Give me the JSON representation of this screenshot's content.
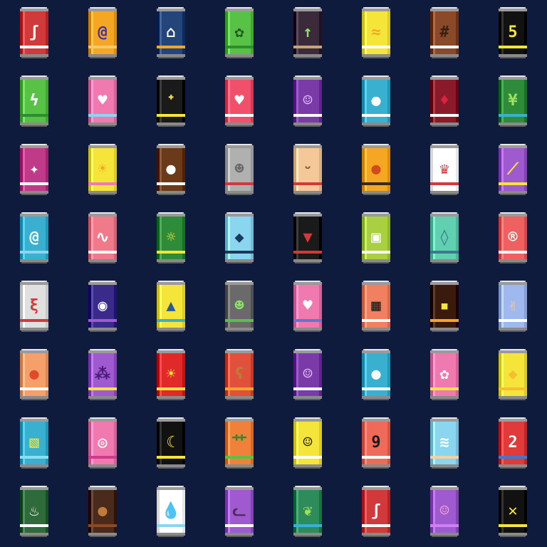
{
  "page": {
    "background": "#0f1b3d"
  },
  "grid": {
    "columns": 8,
    "rows": 8
  },
  "cans": [
    {
      "color": "#d03a3a",
      "band": "#ffffff",
      "icon": "squiggle-icon",
      "glyph": "ʃ",
      "fg": "#ffffff"
    },
    {
      "color": "#f5a623",
      "band": "#f7c86a",
      "icon": "swirl-logo-icon",
      "glyph": "@",
      "fg": "#3b2fa8"
    },
    {
      "color": "#24457a",
      "band": "#f5a623",
      "icon": "mountain-icon",
      "glyph": "⌂",
      "fg": "#ffffff"
    },
    {
      "color": "#58c247",
      "band": "#2e8b2e",
      "icon": "leaf-face-icon",
      "glyph": "✿",
      "fg": "#1d5e1d"
    },
    {
      "color": "#3a2a3a",
      "band": "#c9a27a",
      "icon": "sprout-icon",
      "glyph": "↑",
      "fg": "#8ee06a"
    },
    {
      "color": "#f5e53a",
      "band": "#ffffff",
      "icon": "wave-icon",
      "glyph": "≈",
      "fg": "#f5a623"
    },
    {
      "color": "#8a4a2a",
      "band": "#ffffff",
      "icon": "grid-icon",
      "glyph": "#",
      "fg": "#3a1e10"
    },
    {
      "color": "#111111",
      "band": "#f5e53a",
      "icon": "number-five-icon",
      "glyph": "5",
      "fg": "#f5e53a"
    },
    {
      "color": "#58c247",
      "band": "#2e8b2e",
      "icon": "lightning-icon",
      "glyph": "ϟ",
      "fg": "#ffffff"
    },
    {
      "color": "#f07ab0",
      "band": "#8ad6f0",
      "icon": "heart-badge-icon",
      "glyph": "♥",
      "fg": "#ffffff"
    },
    {
      "color": "#1a1a1a",
      "band": "#f5e53a",
      "icon": "running-man-icon",
      "glyph": "ᐩ",
      "fg": "#f5e53a"
    },
    {
      "color": "#f0506a",
      "band": "#ffffff",
      "icon": "heart-icon",
      "glyph": "♥",
      "fg": "#ffffff"
    },
    {
      "color": "#7a3aa8",
      "band": "#ffffff",
      "icon": "smiley-icon",
      "glyph": "☺",
      "fg": "#e0c0ff"
    },
    {
      "color": "#3ab0d0",
      "band": "#ffffff",
      "icon": "dot-icon",
      "glyph": "●",
      "fg": "#ffffff"
    },
    {
      "color": "#8a1a2a",
      "band": "#ffffff",
      "icon": "drop-icon",
      "glyph": "♦",
      "fg": "#e02040"
    },
    {
      "color": "#2e8b3a",
      "band": "#3ab0d0",
      "icon": "palm-icon",
      "glyph": "¥",
      "fg": "#a0e060"
    },
    {
      "color": "#c03a8a",
      "band": "#ffffff",
      "icon": "sparkle-icon",
      "glyph": "✦",
      "fg": "#ffffff"
    },
    {
      "color": "#f5e53a",
      "band": "#f07ab0",
      "icon": "bulb-icon",
      "glyph": "☀",
      "fg": "#f5a623"
    },
    {
      "color": "#6a3a1a",
      "band": "#ffffff",
      "icon": "coffee-bean-icon",
      "glyph": "●",
      "fg": "#ffffff"
    },
    {
      "color": "#b0b0b0",
      "band": "#d03a3a",
      "icon": "robot-face-icon",
      "glyph": "☻",
      "fg": "#6a6a6a"
    },
    {
      "color": "#f5c89a",
      "band": "#d03a3a",
      "icon": "face-icon",
      "glyph": "ᵕ",
      "fg": "#8a4a2a"
    },
    {
      "color": "#f5a623",
      "band": "#3a2a1a",
      "icon": "fruit-icon",
      "glyph": "●",
      "fg": "#d04a1a"
    },
    {
      "color": "#ffffff",
      "band": "#d03a3a",
      "icon": "princess-icon",
      "glyph": "♛",
      "fg": "#d03a3a"
    },
    {
      "color": "#a05ad0",
      "band": "#f5e53a",
      "icon": "diagonal-lines-icon",
      "glyph": "⟋",
      "fg": "#f5e53a"
    },
    {
      "color": "#3ab0d0",
      "band": "#8ad6f0",
      "icon": "spiral-icon",
      "glyph": "@",
      "fg": "#ffffff"
    },
    {
      "color": "#f07a8a",
      "band": "#ffffff",
      "icon": "line-graph-icon",
      "glyph": "∿",
      "fg": "#ffffff"
    },
    {
      "color": "#2e8b3a",
      "band": "#f5e53a",
      "icon": "sun-stripe-icon",
      "glyph": "☼",
      "fg": "#f5e53a"
    },
    {
      "color": "#8ad6f0",
      "band": "#1a3a5a",
      "icon": "shark-icon",
      "glyph": "◆",
      "fg": "#1a3a5a"
    },
    {
      "color": "#1a1a1a",
      "band": "#d03a3a",
      "icon": "fangs-icon",
      "glyph": "▼",
      "fg": "#d03a3a"
    },
    {
      "color": "#a8d040",
      "band": "#ffffff",
      "icon": "qr-box-icon",
      "glyph": "▣",
      "fg": "#ffffff"
    },
    {
      "color": "#60d0b0",
      "band": "#3a7a8a",
      "icon": "gem-icon",
      "glyph": "◊",
      "fg": "#3a7a8a"
    },
    {
      "color": "#f06060",
      "band": "#ffffff",
      "icon": "registered-icon",
      "glyph": "®",
      "fg": "#ffffff"
    },
    {
      "color": "#e0e0e0",
      "band": "#d03a3a",
      "icon": "scribble-icon",
      "glyph": "ξ",
      "fg": "#d03a3a"
    },
    {
      "color": "#3a2a8a",
      "band": "#a05ad0",
      "icon": "eye-icon",
      "glyph": "◉",
      "fg": "#ffffff"
    },
    {
      "color": "#f5e53a",
      "band": "#3ab0d0",
      "icon": "mountain-peak-icon",
      "glyph": "▲",
      "fg": "#2a5a9a"
    },
    {
      "color": "#6a6a6a",
      "band": "#58c247",
      "icon": "alien-icon",
      "glyph": "☻",
      "fg": "#8ee06a"
    },
    {
      "color": "#f07ab0",
      "band": "#5a7ad0",
      "icon": "shield-icon",
      "glyph": "♥",
      "fg": "#ffffff"
    },
    {
      "color": "#f08060",
      "band": "#ffffff",
      "icon": "qr-code-icon",
      "glyph": "▦",
      "fg": "#1a1a1a"
    },
    {
      "color": "#3a1a0a",
      "band": "#f5a623",
      "icon": "night-window-icon",
      "glyph": "▪",
      "fg": "#f5e53a"
    },
    {
      "color": "#a0b8f0",
      "band": "#ffffff",
      "icon": "peace-hand-icon",
      "glyph": "✌",
      "fg": "#f5c89a"
    },
    {
      "color": "#f5a06a",
      "band": "#ffffff",
      "icon": "apple-icon",
      "glyph": "●",
      "fg": "#e04a2a"
    },
    {
      "color": "#a05ad0",
      "band": "#f5e53a",
      "icon": "grapes-icon",
      "glyph": "⁂",
      "fg": "#4a1a7a"
    },
    {
      "color": "#e02a2a",
      "band": "#f5e53a",
      "icon": "sun-icon",
      "glyph": "☀",
      "fg": "#f5e53a"
    },
    {
      "color": "#e0503a",
      "band": "#f5a623",
      "icon": "bear-icon",
      "glyph": "ʕ",
      "fg": "#c07a3a"
    },
    {
      "color": "#7a3aa8",
      "band": "#ffffff",
      "icon": "smiley-icon",
      "glyph": "☺",
      "fg": "#e0c0ff"
    },
    {
      "color": "#3ab0d0",
      "band": "#ffffff",
      "icon": "dot-icon",
      "glyph": "●",
      "fg": "#ffffff"
    },
    {
      "color": "#f07ab0",
      "band": "#f5e53a",
      "icon": "flowers-icon",
      "glyph": "✿",
      "fg": "#ffffff"
    },
    {
      "color": "#f5e53a",
      "band": "#f5c030",
      "icon": "lemon-icon",
      "glyph": "◆",
      "fg": "#f5c030"
    },
    {
      "color": "#3ab0d0",
      "band": "#8ae0f0",
      "icon": "stripes-icon",
      "glyph": "▧",
      "fg": "#f5e53a"
    },
    {
      "color": "#f07ab0",
      "band": "#d03a8a",
      "icon": "donut-icon",
      "glyph": "◎",
      "fg": "#ffffff"
    },
    {
      "color": "#111111",
      "band": "#f5e53a",
      "icon": "moon-icon",
      "glyph": "☾",
      "fg": "#f5e53a"
    },
    {
      "color": "#f0803a",
      "band": "#58c247",
      "icon": "grass-icon",
      "glyph": "⺾",
      "fg": "#2e8b2e"
    },
    {
      "color": "#f5e53a",
      "band": "#ffffff",
      "icon": "wink-face-icon",
      "glyph": "☺",
      "fg": "#1a1a1a"
    },
    {
      "color": "#f06a5a",
      "band": "#ffffff",
      "icon": "number-nine-icon",
      "glyph": "9",
      "fg": "#1a1a1a"
    },
    {
      "color": "#8ad6f0",
      "band": "#f5d0a0",
      "icon": "beach-icon",
      "glyph": "≋",
      "fg": "#ffffff"
    },
    {
      "color": "#e03a3a",
      "band": "#3a7ad0",
      "icon": "rainbow-icon",
      "glyph": "2",
      "fg": "#ffffff"
    },
    {
      "color": "#2e6a3a",
      "band": "#ffffff",
      "icon": "steaming-bowl-icon",
      "glyph": "♨",
      "fg": "#ffffff"
    },
    {
      "color": "#4a2a1a",
      "band": "#8a4a2a",
      "icon": "coffee-icon",
      "glyph": "●",
      "fg": "#c07a3a"
    },
    {
      "color": "#ffffff",
      "band": "#8ad6f0",
      "icon": "water-drop-icon",
      "glyph": "💧",
      "fg": "#3ab0d0"
    },
    {
      "color": "#a05ad0",
      "band": "#ffffff",
      "icon": "cat-icon",
      "glyph": "ᓚ",
      "fg": "#4a2a5a"
    },
    {
      "color": "#2e8b5a",
      "band": "#3ab0d0",
      "icon": "leaf-icon",
      "glyph": "❦",
      "fg": "#a0e060"
    },
    {
      "color": "#d03a3a",
      "band": "#ffffff",
      "icon": "scribble-icon",
      "glyph": "ʃ",
      "fg": "#ffffff"
    },
    {
      "color": "#a05ad0",
      "band": "#d080f0",
      "icon": "jellyfish-icon",
      "glyph": "☺",
      "fg": "#f0a0d0"
    },
    {
      "color": "#111111",
      "band": "#f5e53a",
      "icon": "x-mark-icon",
      "glyph": "✕",
      "fg": "#f5e53a"
    }
  ]
}
